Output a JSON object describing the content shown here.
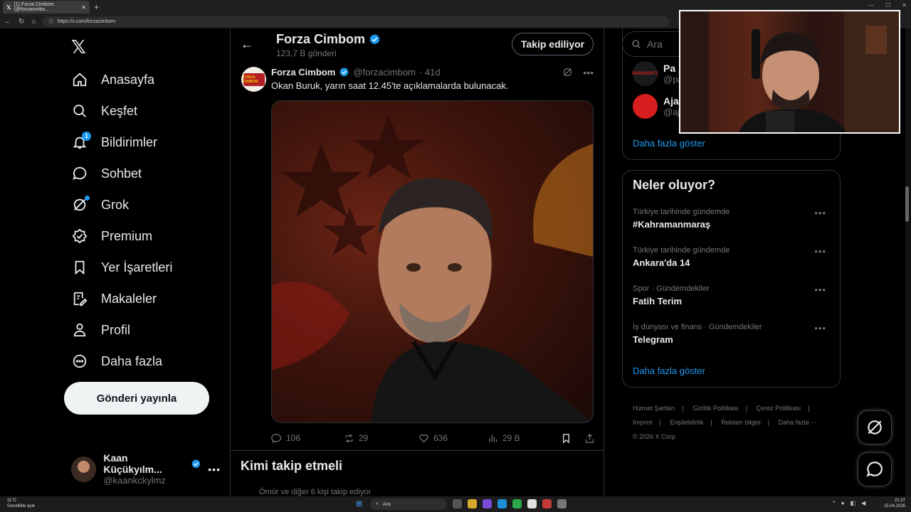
{
  "browser": {
    "tab_title": "(1) Forza Cimbom (@forzacimbo...",
    "url": "https://x.com/forzacimbom",
    "new_tab": "+",
    "tab_close": "✕"
  },
  "nav": {
    "items": [
      {
        "label": "Anasayfa",
        "icon": "home-icon"
      },
      {
        "label": "Keşfet",
        "icon": "search-icon"
      },
      {
        "label": "Bildirimler",
        "icon": "bell-icon",
        "badge": "1"
      },
      {
        "label": "Sohbet",
        "icon": "chat-icon"
      },
      {
        "label": "Grok",
        "icon": "grok-icon"
      },
      {
        "label": "Premium",
        "icon": "premium-icon"
      },
      {
        "label": "Yer İşaretleri",
        "icon": "bookmark-icon"
      },
      {
        "label": "Makaleler",
        "icon": "article-icon"
      },
      {
        "label": "Profil",
        "icon": "person-icon"
      },
      {
        "label": "Daha fazla",
        "icon": "more-icon"
      }
    ],
    "post_button": "Gönderi yayınla",
    "account": {
      "name": "Kaan Küçükyılm...",
      "handle": "@kaankckylmz",
      "more": "•••"
    }
  },
  "profile_header": {
    "name": "Forza Cimbom",
    "post_count": "123,7 B gönderi",
    "follow_button": "Takip ediliyor",
    "back": "←"
  },
  "tweet": {
    "name": "Forza Cimbom",
    "handle": "@forzacimbom",
    "time": "· 41d",
    "text": "Okan Buruk, yarın saat 12.45'te açıklamalarda bulunacak.",
    "avatar_text": "FORZA CIMBOM",
    "more": "•••",
    "replies": "106",
    "retweets": "29",
    "likes": "636",
    "views": "29 B"
  },
  "who_to_follow": {
    "title": "Kimi takip etmeli",
    "partial_text": "Ömür ve diğer 6 kişi takip ediyor"
  },
  "right": {
    "search_placeholder": "Ara",
    "suggestions": [
      {
        "name": "Pa",
        "handle": "@pa",
        "avatar_text": "PARSPORTZ"
      },
      {
        "name": "Aja",
        "handle": "@aj"
      }
    ],
    "show_more_1": "Daha fazla göster",
    "trends_title": "Neler oluyor?",
    "trends": [
      {
        "meta": "Türkiye tarihinde gündemde",
        "name": "#Kahramanmaraş"
      },
      {
        "meta": "Türkiye tarihinde gündemde",
        "name": "Ankara'da 14"
      },
      {
        "meta": "Spor · Gündemdekiler",
        "name": "Fatih Terim"
      },
      {
        "meta": "İş dünyası ve finans · Gündemdekiler",
        "name": "Telegram"
      }
    ],
    "trend_more": "•••",
    "show_more_2": "Daha fazla göster",
    "footer": [
      "Hizmet Şartları",
      "|",
      "Gizlilik Politikası",
      "|",
      "Çerez Politikası",
      "|",
      "Imprint",
      "|",
      "Erişilebilirlik",
      "|",
      "Reklam bilgisi",
      "|",
      "Daha fazla ···",
      "© 2026 X Corp."
    ]
  },
  "taskbar": {
    "weather_temp": "11°C",
    "weather_desc": "Genellikle açık",
    "search": "Ara",
    "time": "21:37",
    "date": "15.04.2026"
  },
  "colors": {
    "accent": "#1d9bf0",
    "background": "#000000",
    "border": "#2f3336",
    "muted": "#71767b"
  }
}
